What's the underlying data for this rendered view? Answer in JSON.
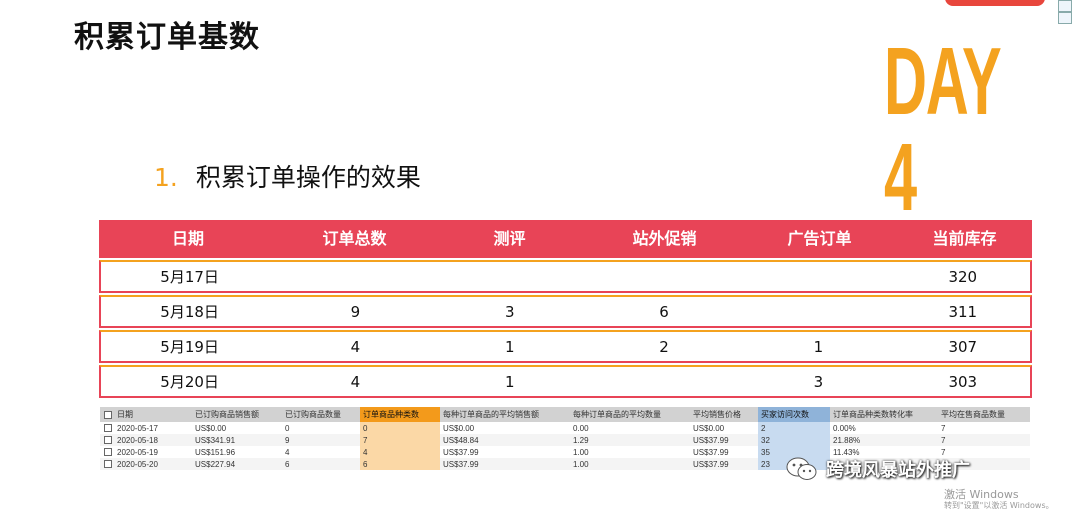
{
  "slide": {
    "title": "积累订单基数",
    "badge": "DAY 4",
    "section_number": "1.",
    "section_heading": "积累订单操作的效果"
  },
  "main_table": {
    "headers": [
      "日期",
      "订单总数",
      "测评",
      "站外促销",
      "广告订单",
      "当前库存"
    ],
    "rows": [
      [
        "5月17日",
        "",
        "",
        "",
        "",
        "320"
      ],
      [
        "5月18日",
        "9",
        "3",
        "6",
        "",
        "311"
      ],
      [
        "5月19日",
        "4",
        "1",
        "2",
        "1",
        "307"
      ],
      [
        "5月20日",
        "4",
        "1",
        "",
        "3",
        "303"
      ]
    ]
  },
  "sheet": {
    "headers": [
      "日期",
      "已订购商品销售额",
      "已订购商品数量",
      "订单商品种类数",
      "每种订单商品的平均销售额",
      "每种订单商品的平均数量",
      "平均销售价格",
      "买家访问次数",
      "订单商品种类数转化率",
      "平均在售商品数量"
    ],
    "rows": [
      [
        "2020-05-17",
        "US$0.00",
        "0",
        "0",
        "US$0.00",
        "0.00",
        "US$0.00",
        "2",
        "0.00%",
        "7"
      ],
      [
        "2020-05-18",
        "US$341.91",
        "9",
        "7",
        "US$48.84",
        "1.29",
        "US$37.99",
        "32",
        "21.88%",
        "7"
      ],
      [
        "2020-05-19",
        "US$151.96",
        "4",
        "4",
        "US$37.99",
        "1.00",
        "US$37.99",
        "35",
        "11.43%",
        "7"
      ],
      [
        "2020-05-20",
        "US$227.94",
        "6",
        "6",
        "US$37.99",
        "1.00",
        "US$37.99",
        "23",
        "",
        ""
      ]
    ]
  },
  "watermark": {
    "wechat_text": "跨境风暴站外推广",
    "activate_line1": "激活 Windows",
    "activate_line2": "转到\"设置\"以激活 Windows。"
  },
  "colors": {
    "header_red": "#e84457",
    "accent_orange": "#f4a21f",
    "sheet_orange": "#f39a1b",
    "sheet_blue": "#8fb3d9"
  }
}
